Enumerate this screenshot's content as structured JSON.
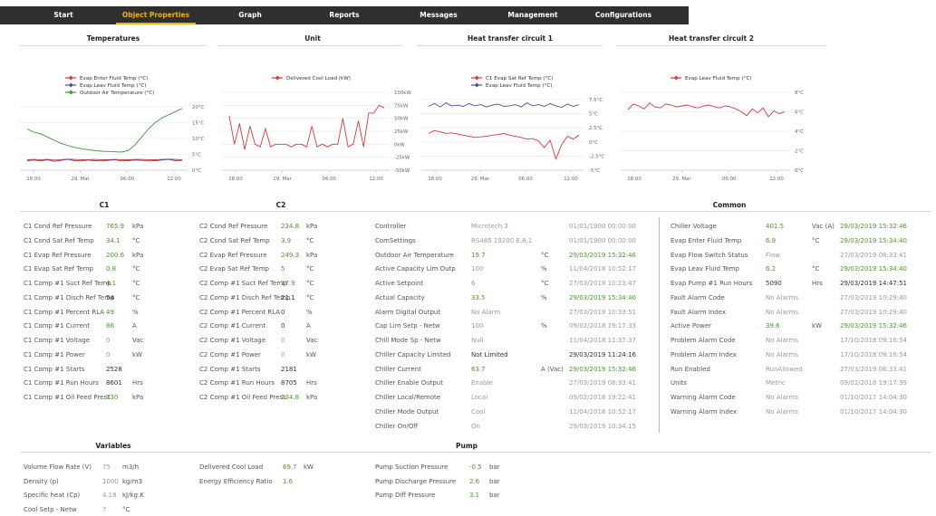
{
  "nav": {
    "items": [
      "Start",
      "Object Properties",
      "Graph",
      "Reports",
      "Messages",
      "Management",
      "Configurations"
    ],
    "active": 1
  },
  "sections": {
    "temperatures": "Temperatures",
    "unit": "Unit",
    "htc1": "Heat transfer circuit 1",
    "htc2": "Heat transfer circuit 2",
    "c1": "C1",
    "c2": "C2",
    "common": "Common",
    "variables": "Variables",
    "pump": "Pump"
  },
  "colors": {
    "red": "#d9383a",
    "blue": "#4b4dab",
    "green": "#3f9b3a",
    "value_green": "#4a9a27",
    "active_nav": "#f0b400",
    "navbar": "#2f2f2f"
  },
  "chart_data": [
    {
      "type": "line",
      "id": "temperatures",
      "title": "",
      "x_ticks": [
        "18:00",
        "29. Mar",
        "06:00",
        "12:00"
      ],
      "y_ticks": [
        "0°C",
        "5°C",
        "10°C",
        "15°C",
        "20°C"
      ],
      "ylim": [
        0,
        20
      ],
      "series": [
        {
          "name": "Evap Enter Fluid Temp (°C)",
          "color": "#d9383a",
          "values": [
            3.3,
            3.4,
            3.3,
            3.4,
            3.2,
            3.3,
            3.5,
            3.4,
            3.3,
            3.3,
            3.4,
            3.3,
            3.3,
            3.4,
            3.3,
            3.3,
            3.4,
            3.4,
            3.3,
            3.3,
            3.4,
            3.5,
            3.4,
            3.3
          ]
        },
        {
          "name": "Evap Leav Fluid Temp (°C)",
          "color": "#4b4dab",
          "values": [
            3.0,
            3.2,
            2.9,
            3.3,
            2.8,
            3.1,
            3.4,
            3.0,
            2.9,
            3.2,
            3.0,
            2.9,
            3.1,
            3.3,
            2.9,
            3.0,
            3.2,
            3.1,
            2.9,
            3.0,
            3.2,
            3.4,
            3.0,
            3.1
          ]
        },
        {
          "name": "Outdoor Air Temperature (°C)",
          "color": "#3f9b3a",
          "values": [
            13,
            12,
            11.5,
            10.5,
            9.5,
            8.5,
            7.8,
            7.2,
            6.8,
            6.5,
            6.2,
            6.0,
            5.9,
            5.8,
            5.7,
            6.2,
            8,
            10.5,
            13,
            15,
            16.5,
            17.5,
            18.5,
            19.5
          ]
        }
      ]
    },
    {
      "type": "line",
      "id": "unit",
      "title": "",
      "x_ticks": [
        "18:00",
        "29. Mar",
        "06:00",
        "12:00"
      ],
      "y_ticks": [
        "-50kW",
        "-25kW",
        "0kW",
        "25kW",
        "50kW",
        "75kW",
        "100kW"
      ],
      "ylim": [
        -50,
        100
      ],
      "series": [
        {
          "name": "Delivered Cool Load (kW)",
          "color": "#d9383a",
          "values": [
            55,
            0,
            40,
            -10,
            35,
            0,
            -5,
            30,
            -5,
            0,
            0,
            0,
            -5,
            0,
            0,
            -5,
            35,
            -5,
            0,
            -5,
            0,
            0,
            50,
            -5,
            0,
            45,
            -5,
            60,
            60,
            75,
            70
          ]
        }
      ]
    },
    {
      "type": "line",
      "id": "htc1",
      "title": "",
      "x_ticks": [
        "18:00",
        "29. Mar",
        "06:00",
        "12:00"
      ],
      "y_ticks": [
        "-5°C",
        "-2.5°C",
        "0°C",
        "2.5°C",
        "5°C",
        "7.5°C"
      ],
      "ylim": [
        -5,
        7.5
      ],
      "series": [
        {
          "name": "C1 Evap Sat Ref Temp (°C)",
          "color": "#d9383a",
          "values": [
            1.5,
            2.0,
            1.8,
            1.5,
            1.6,
            1.4,
            1.2,
            1.0,
            0.8,
            0.9,
            1.0,
            1.2,
            1.3,
            1.5,
            1.2,
            1.0,
            0.8,
            0.5,
            0.6,
            0.2,
            -1.0,
            0.3,
            -3.0,
            -0.5,
            1.0,
            0.5,
            1.2
          ]
        },
        {
          "name": "Evap Leav Fluid Temp (°C)",
          "color": "#4b4dab",
          "values": [
            6.3,
            6.8,
            6.2,
            6.9,
            6.4,
            6.5,
            6.3,
            6.8,
            6.4,
            6.6,
            6.2,
            6.5,
            6.7,
            6.3,
            6.4,
            6.6,
            6.2,
            6.9,
            6.4,
            6.6,
            6.3,
            6.8,
            6.4,
            6.1,
            6.7,
            6.3,
            6.6
          ]
        }
      ]
    },
    {
      "type": "line",
      "id": "htc2",
      "title": "",
      "x_ticks": [
        "18:00",
        "29. Mar",
        "06:00",
        "12:00"
      ],
      "y_ticks": [
        "0°C",
        "2°C",
        "4°C",
        "6°C",
        "8°C"
      ],
      "ylim": [
        0,
        8
      ],
      "series": [
        {
          "name": "Evap Leav Fluid Temp (°C)",
          "color": "#d9383a",
          "values": [
            6.2,
            6.8,
            6.6,
            6.3,
            6.9,
            6.5,
            6.4,
            6.8,
            6.7,
            6.5,
            6.6,
            6.7,
            6.5,
            6.4,
            6.6,
            6.7,
            6.5,
            6.4,
            6.6,
            6.5,
            6.3,
            6.0,
            5.6,
            6.3,
            5.9,
            6.4,
            5.5,
            6.1,
            5.8,
            6.0
          ]
        }
      ]
    }
  ],
  "c1": [
    {
      "label": "C1 Cond Ref Pressure",
      "value": "765.9",
      "unit": "kPa",
      "s": "v"
    },
    {
      "label": "C1 Cond Sat Ref Temp",
      "value": "34.1",
      "unit": "°C",
      "s": "v"
    },
    {
      "label": "C1 Evap Ref Pressure",
      "value": "200.6",
      "unit": "kPa",
      "s": "v"
    },
    {
      "label": "C1 Evap Sat Ref Temp",
      "value": "0.8",
      "unit": "°C",
      "s": "v"
    },
    {
      "label": "C1 Comp #1 Suct Ref Temp",
      "value": "4.1",
      "unit": "°C",
      "s": "v"
    },
    {
      "label": "C1 Comp #1 Disch Ref Temp",
      "value": "54",
      "unit": "°C",
      "s": "k"
    },
    {
      "label": "C1 Comp #1 Percent RLA",
      "value": "49",
      "unit": "%",
      "s": "v"
    },
    {
      "label": "C1 Comp #1 Current",
      "value": "86",
      "unit": "A",
      "s": "v"
    },
    {
      "label": "C1 Comp #1 Voltage",
      "value": "0",
      "unit": "Vac",
      "s": "g"
    },
    {
      "label": "C1 Comp #1 Power",
      "value": "0",
      "unit": "kW",
      "s": "g"
    },
    {
      "label": "C1 Comp #1 Starts",
      "value": "2528",
      "unit": "",
      "s": "k"
    },
    {
      "label": "C1 Comp #1 Run Hours",
      "value": "8601",
      "unit": "Hrs",
      "s": "k"
    },
    {
      "label": "C1 Comp #1 Oil Feed Press",
      "value": "730",
      "unit": "kPa",
      "s": "v"
    }
  ],
  "c2": [
    {
      "label": "C2 Cond Ref Pressure",
      "value": "234.8",
      "unit": "kPa",
      "s": "v"
    },
    {
      "label": "C2 Cond Sat Ref Temp",
      "value": "3.9",
      "unit": "°C",
      "s": "v"
    },
    {
      "label": "C2 Evap Ref Pressure",
      "value": "249.3",
      "unit": "kPa",
      "s": "v"
    },
    {
      "label": "C2 Evap Sat Ref Temp",
      "value": "5",
      "unit": "°C",
      "s": "v"
    },
    {
      "label": "C2 Comp #1 Suct Ref Temp",
      "value": "17.9",
      "unit": "°C",
      "s": "v"
    },
    {
      "label": "C2 Comp #1 Disch Ref Temp",
      "value": "21.1",
      "unit": "°C",
      "s": "k"
    },
    {
      "label": "C2 Comp #1 Percent RLA",
      "value": "0",
      "unit": "%",
      "s": "k"
    },
    {
      "label": "C2 Comp #1 Current",
      "value": "0",
      "unit": "A",
      "s": "k"
    },
    {
      "label": "C2 Comp #1 Voltage",
      "value": "0",
      "unit": "Vac",
      "s": "g"
    },
    {
      "label": "C2 Comp #1 Power",
      "value": "0",
      "unit": "kW",
      "s": "g"
    },
    {
      "label": "C2 Comp #1 Starts",
      "value": "2181",
      "unit": "",
      "s": "k"
    },
    {
      "label": "C2 Comp #1 Run Hours",
      "value": "8705",
      "unit": "Hrs",
      "s": "k"
    },
    {
      "label": "C2 Comp #1 Oil Feed Press",
      "value": "234.8",
      "unit": "kPa",
      "s": "v"
    }
  ],
  "common_left": [
    {
      "label": "Controller",
      "value": "Microtech 3",
      "unit": "",
      "ts": "01/01/1900 00:00:00",
      "s": "g",
      "t": "g"
    },
    {
      "label": "ComSettings",
      "value": "RS485 19200 E,8,1",
      "unit": "",
      "ts": "01/01/1900 00:00:00",
      "s": "g",
      "t": "g"
    },
    {
      "label": "Outdoor Air Temperature",
      "value": "19.7",
      "unit": "°C",
      "ts": "29/03/2019 15:32:46",
      "s": "v",
      "t": "v"
    },
    {
      "label": "Active Capacity Lim Outp",
      "value": "100",
      "unit": "%",
      "ts": "11/04/2018 10:52:17",
      "s": "g",
      "t": "g"
    },
    {
      "label": "Active Setpoint",
      "value": "6",
      "unit": "°C",
      "ts": "27/03/2019 10:23:47",
      "s": "g",
      "t": "g"
    },
    {
      "label": "Actual Capacity",
      "value": "33.5",
      "unit": "%",
      "ts": "29/03/2019 15:34:40",
      "s": "v",
      "t": "v"
    },
    {
      "label": "Alarm Digital Output",
      "value": "No Alarm",
      "unit": "",
      "ts": "27/03/2019 10:33:51",
      "s": "g",
      "t": "g"
    },
    {
      "label": "Cap Lim Setp - Netw",
      "value": "100",
      "unit": "%",
      "ts": "09/02/2018 19:17:33",
      "s": "g",
      "t": "g"
    },
    {
      "label": "Chill Mode Sp - Netw",
      "value": "Null",
      "unit": "",
      "ts": "11/04/2018 11:37:37",
      "s": "g",
      "t": "g"
    },
    {
      "label": "Chiller Capacity Limited",
      "value": "Not Limited",
      "unit": "",
      "ts": "29/03/2019 11:24:16",
      "s": "k",
      "t": "k"
    },
    {
      "label": "Chiller Current",
      "value": "63.7",
      "unit": "A (Vac)",
      "ts": "29/03/2019 15:32:46",
      "s": "v",
      "t": "v"
    },
    {
      "label": "Chiller Enable Output",
      "value": "Enable",
      "unit": "",
      "ts": "27/03/2019 08:33:41",
      "s": "g",
      "t": "g"
    },
    {
      "label": "Chiller Local/Remote",
      "value": "Local",
      "unit": "",
      "ts": "09/02/2018 19:22:41",
      "s": "g",
      "t": "g"
    },
    {
      "label": "Chiller Mode Output",
      "value": "Cool",
      "unit": "",
      "ts": "11/04/2018 10:52:17",
      "s": "g",
      "t": "g"
    },
    {
      "label": "Chiller On/Off",
      "value": "On",
      "unit": "",
      "ts": "29/03/2019 10:34:15",
      "s": "g",
      "t": "g"
    }
  ],
  "common_right": [
    {
      "label": "Chiller Voltage",
      "value": "401.5",
      "unit": "Vac (A)",
      "ts": "29/03/2019 15:32:46",
      "s": "v",
      "t": "v"
    },
    {
      "label": "Evap Enter Fluid Temp",
      "value": "6.9",
      "unit": "°C",
      "ts": "29/03/2019 15:34:40",
      "s": "v",
      "t": "v"
    },
    {
      "label": "Evap Flow Switch Status",
      "value": "Flow",
      "unit": "",
      "ts": "27/03/2019 08:33:41",
      "s": "g",
      "t": "g"
    },
    {
      "label": "Evap Leav Fluid Temp",
      "value": "6.2",
      "unit": "°C",
      "ts": "29/03/2019 15:34:40",
      "s": "v",
      "t": "v"
    },
    {
      "label": "Evap Pump #1 Run Hours",
      "value": "5090",
      "unit": "Hrs",
      "ts": "29/03/2019 14:47:51",
      "s": "k",
      "t": "k"
    },
    {
      "label": "Fault Alarm Code",
      "value": "No Alarms",
      "unit": "",
      "ts": "27/03/2019 10:29:40",
      "s": "g",
      "t": "g"
    },
    {
      "label": "Fault Alarm Index",
      "value": "No Alarms",
      "unit": "",
      "ts": "27/03/2019 10:29:40",
      "s": "g",
      "t": "g"
    },
    {
      "label": "Active Power",
      "value": "39.6",
      "unit": "kW",
      "ts": "29/03/2019 15:32:46",
      "s": "v",
      "t": "v"
    },
    {
      "label": "Problem Alarm Code",
      "value": "No Alarms",
      "unit": "",
      "ts": "17/10/2018 09:16:54",
      "s": "g",
      "t": "g"
    },
    {
      "label": "Problem Alarm Index",
      "value": "No Alarms",
      "unit": "",
      "ts": "17/10/2018 09:16:54",
      "s": "g",
      "t": "g"
    },
    {
      "label": "Run Enabled",
      "value": "RunAllowed",
      "unit": "",
      "ts": "27/03/2019 08:33:41",
      "s": "g",
      "t": "g"
    },
    {
      "label": "Units",
      "value": "Metric",
      "unit": "",
      "ts": "09/02/2018 19:17:39",
      "s": "g",
      "t": "g"
    },
    {
      "label": "Warning Alarm Code",
      "value": "No Alarms",
      "unit": "",
      "ts": "01/10/2017 14:04:30",
      "s": "g",
      "t": "g"
    },
    {
      "label": "Warning Alarm Index",
      "value": "No Alarms",
      "unit": "",
      "ts": "01/10/2017 14:04:30",
      "s": "g",
      "t": "g"
    }
  ],
  "variables": [
    {
      "label": "Volume Flow Rate (V)",
      "value": "75",
      "unit": "m3/h",
      "s": "g"
    },
    {
      "label": "Density (p)",
      "value": "1000",
      "unit": "kg/m3",
      "s": "g"
    },
    {
      "label": "Specific heat (Cp)",
      "value": "4.18",
      "unit": "kJ/kg.K",
      "s": "g"
    },
    {
      "label": "Cool Setp - Netw",
      "value": "7",
      "unit": "°C",
      "s": "g"
    }
  ],
  "variables2": [
    {
      "label": "Delivered Cool Load",
      "value": "69.7",
      "unit": "kW",
      "s": "v"
    },
    {
      "label": "Energy Efficiency Ratio",
      "value": "1.6",
      "unit": "",
      "s": "v"
    }
  ],
  "pump": [
    {
      "label": "Pump Suction Pressure",
      "value": "-0.5",
      "unit": "bar",
      "s": "v"
    },
    {
      "label": "Pump Discharge Pressure",
      "value": "2.6",
      "unit": "bar",
      "s": "v"
    },
    {
      "label": "Pump Diff Pressure",
      "value": "3.1",
      "unit": "bar",
      "s": "v"
    }
  ]
}
